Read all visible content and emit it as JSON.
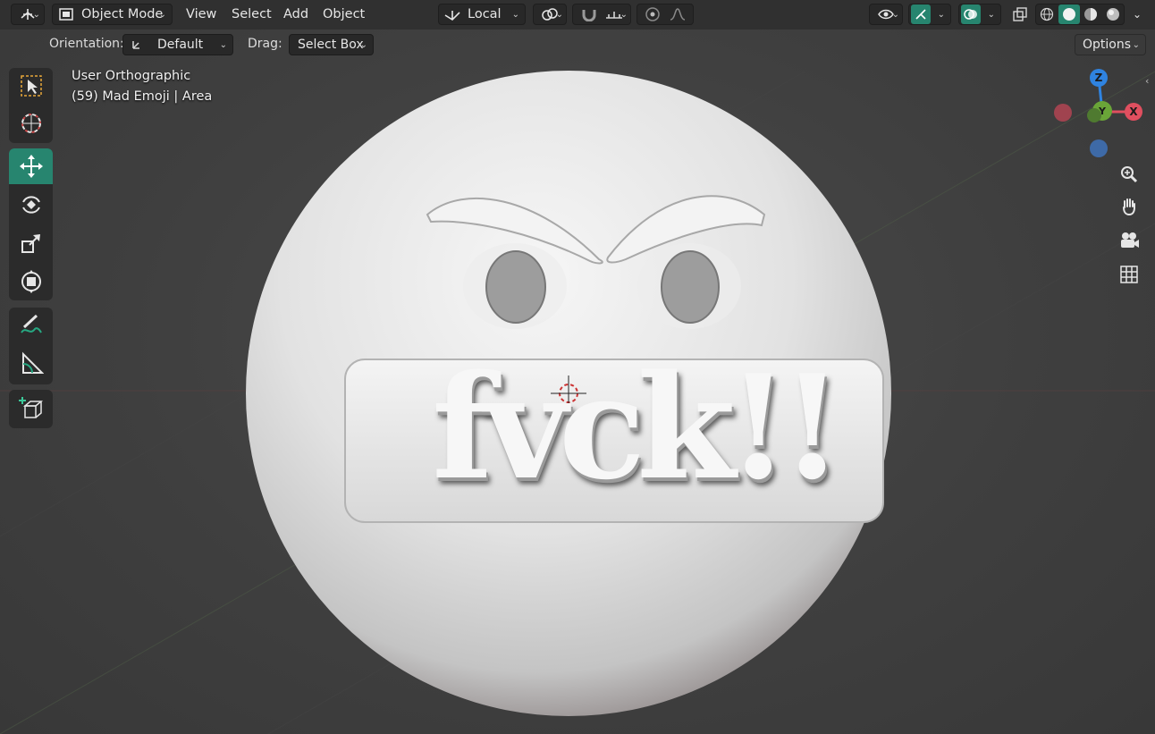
{
  "header": {
    "mode": "Object Mode",
    "menus": [
      "View",
      "Select",
      "Add",
      "Object"
    ],
    "transform_orientation": "Local",
    "options_label": "Options"
  },
  "tool_options": {
    "orientation_label": "Orientation:",
    "orientation_value": "Default",
    "drag_label": "Drag:",
    "drag_value": "Select Box"
  },
  "viewport": {
    "view_name": "User Orthographic",
    "object_info": "(59) Mad Emoji | Area",
    "model_text": "fvck!!"
  },
  "gizmo": {
    "x_label": "X",
    "y_label": "Y",
    "z_label": "Z",
    "x_color": "#e04f5f",
    "y_color": "#6aa538",
    "z_color": "#2f83e0"
  },
  "toolbar": {
    "tools": [
      "select-box",
      "cursor",
      "move",
      "rotate",
      "scale",
      "transform",
      "annotate",
      "measure",
      "add-cube"
    ],
    "active_tool": "move",
    "active_color": "#27856f"
  }
}
